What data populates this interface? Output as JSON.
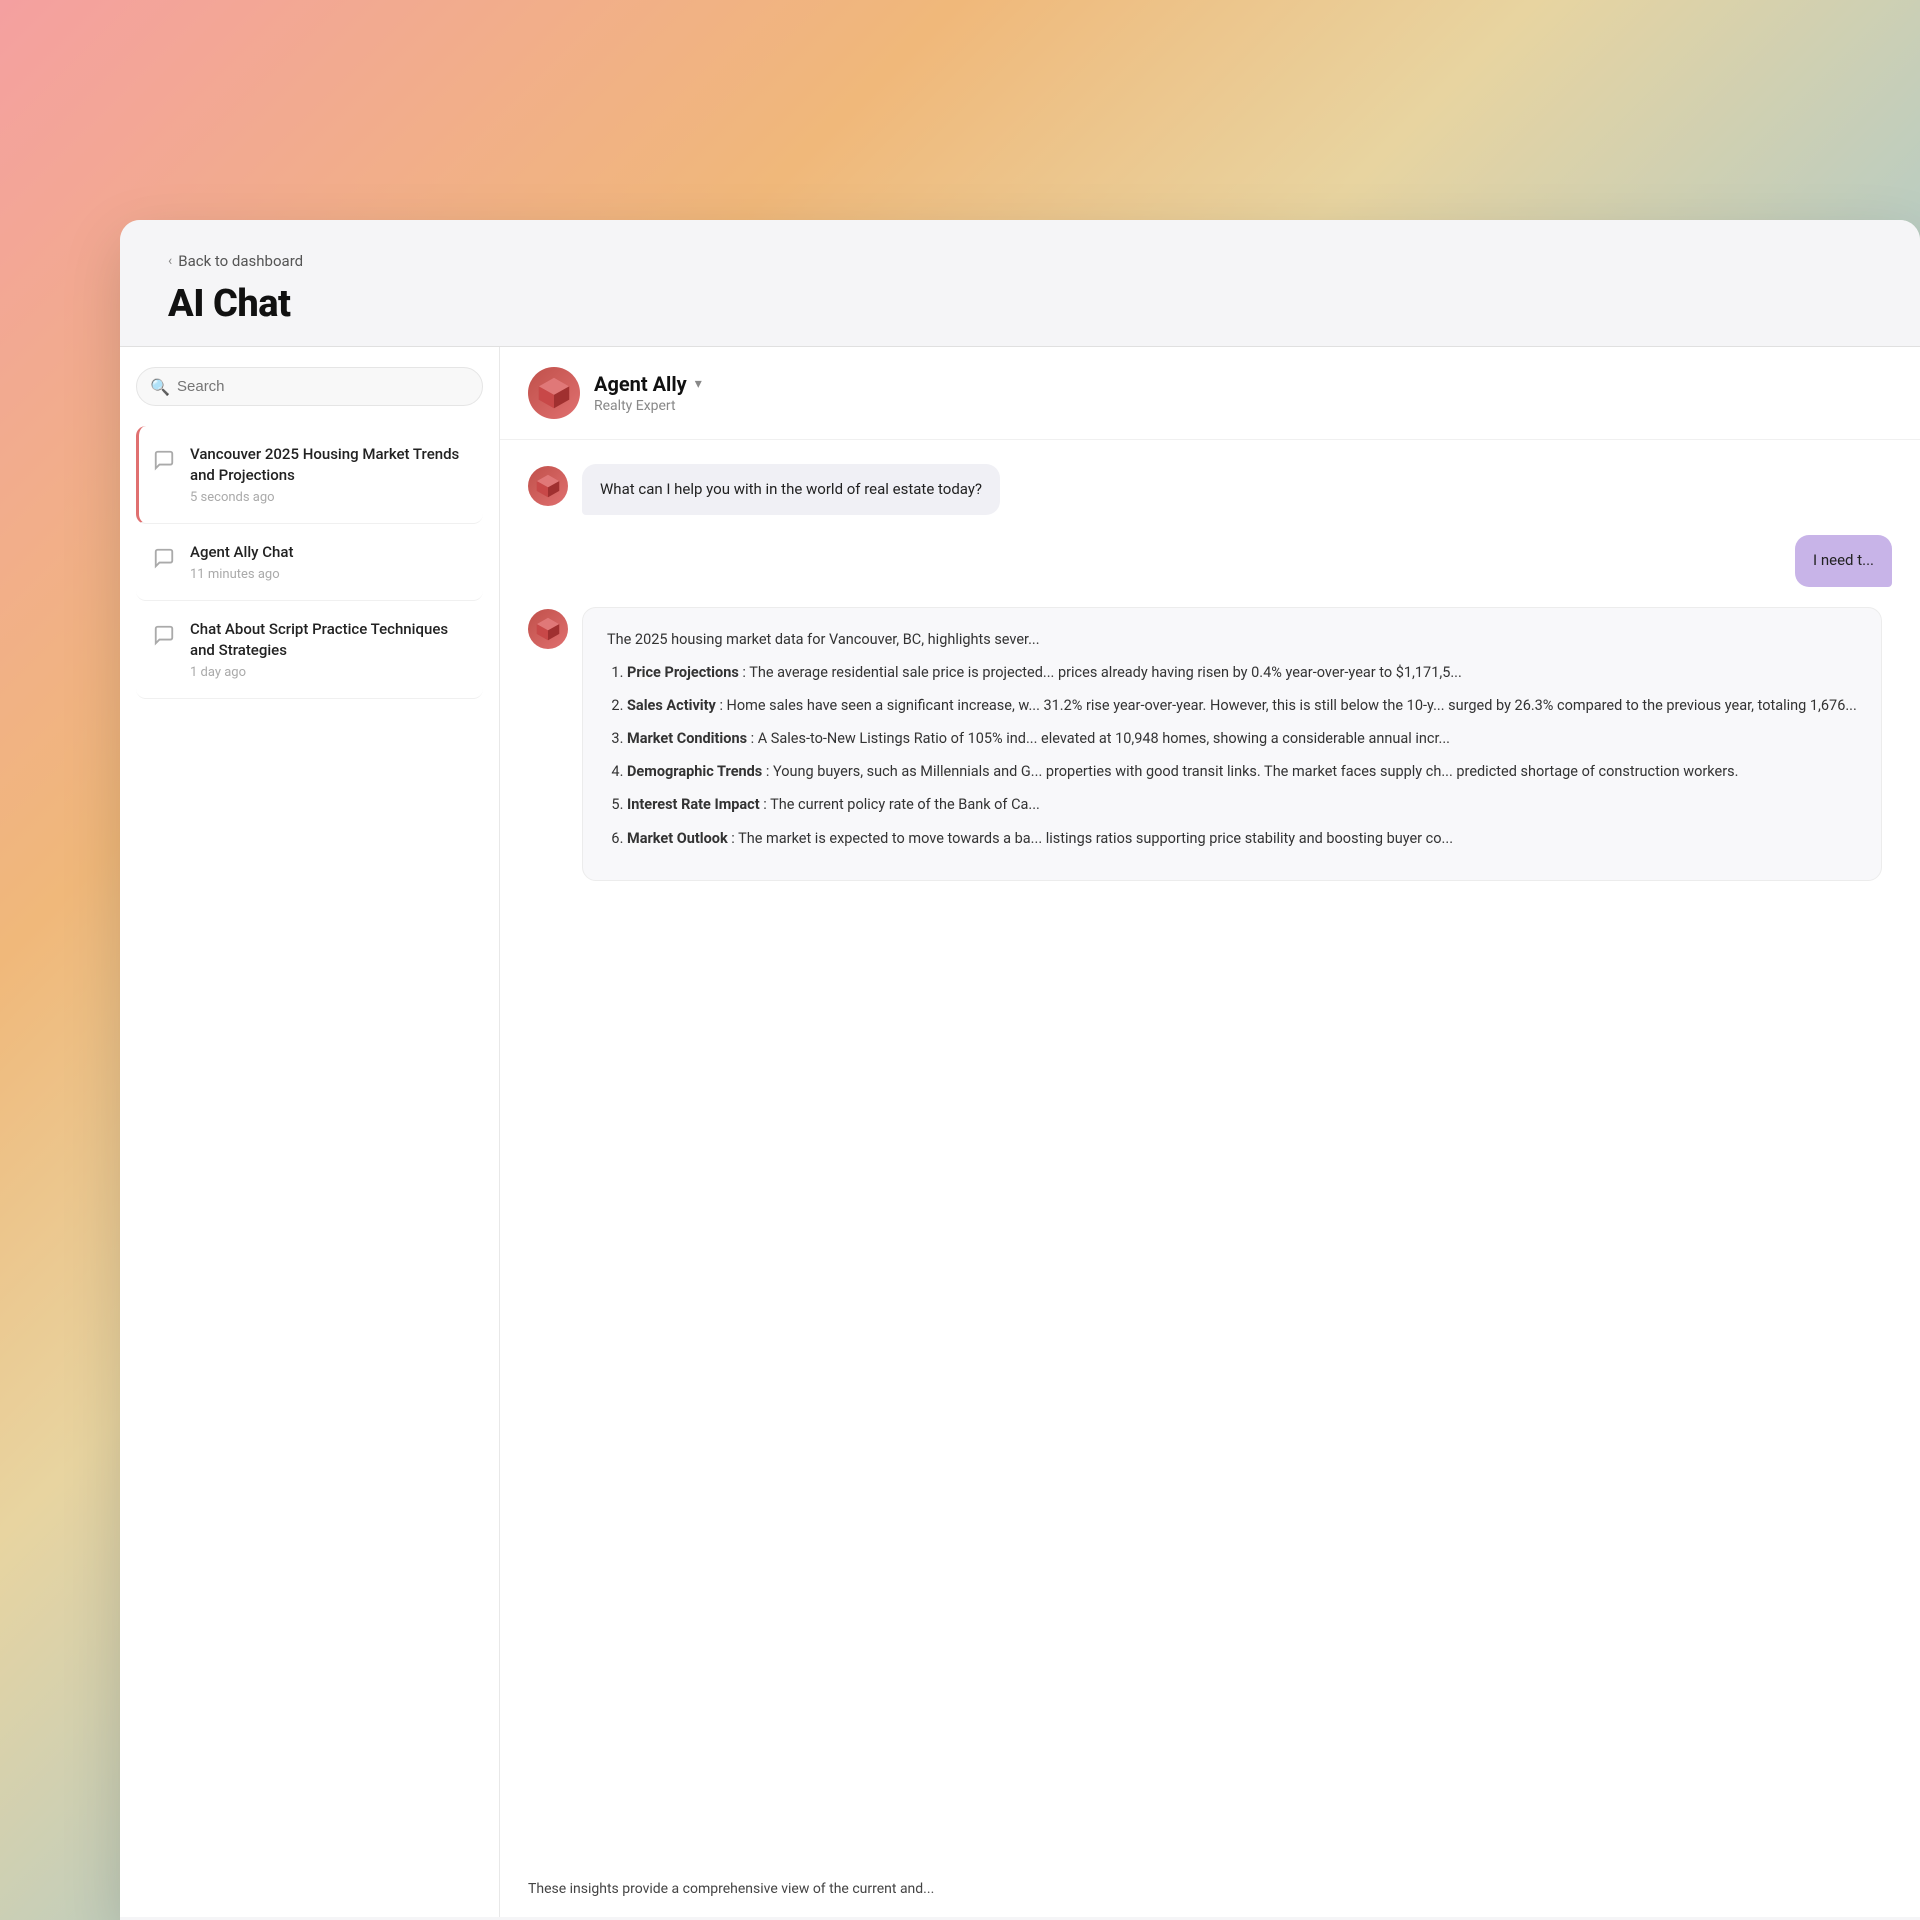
{
  "background": {},
  "nav": {
    "back_label": "Back to dashboard"
  },
  "page": {
    "title": "AI Chat"
  },
  "sidebar": {
    "search_placeholder": "Search",
    "chats": [
      {
        "id": "chat-1",
        "name": "Vancouver 2025 Housing Market Trends and Projections",
        "time": "5 seconds ago",
        "active": true
      },
      {
        "id": "chat-2",
        "name": "Agent Ally Chat",
        "time": "11 minutes ago",
        "active": false
      },
      {
        "id": "chat-3",
        "name": "Chat About Script Practice Techniques and Strategies",
        "time": "1 day ago",
        "active": false
      }
    ]
  },
  "chat": {
    "agent_name": "Agent Ally",
    "agent_subtitle": "Realty Expert",
    "dropdown_label": "Agent Ally ▾",
    "messages": [
      {
        "role": "agent",
        "text": "What can I help you with in the world of real estate today?"
      },
      {
        "role": "user",
        "text": "I need t..."
      }
    ],
    "response_intro": "The 2025 housing market data for Vancouver, BC, highlights sever...",
    "response_items": [
      {
        "label": "Price Projections",
        "text": ": The average residential sale price is projected... prices already having risen by 0.4% year-over-year to $1,171,5..."
      },
      {
        "label": "Sales Activity",
        "text": ": Home sales have seen a significant increase, w... 31.2% rise year-over-year. However, this is still below the 10-y... surged by 26.3% compared to the previous year, totaling 1,676..."
      },
      {
        "label": "Market Conditions",
        "text": ": A Sales-to-New Listings Ratio of 105% ind... elevated at 10,948 homes, showing a considerable annual incr..."
      },
      {
        "label": "Demographic Trends",
        "text": ": Young buyers, such as Millennials and G... properties with good transit links. The market faces supply ch... predicted shortage of construction workers."
      },
      {
        "label": "Interest Rate Impact",
        "text": ": The current policy rate of the Bank of Ca..."
      },
      {
        "label": "Market Outlook",
        "text": ": The market is expected to move towards a ba... listings ratios supporting price stability and boosting buyer co..."
      }
    ],
    "response_footer": "These insights provide a comprehensive view of the current and..."
  }
}
